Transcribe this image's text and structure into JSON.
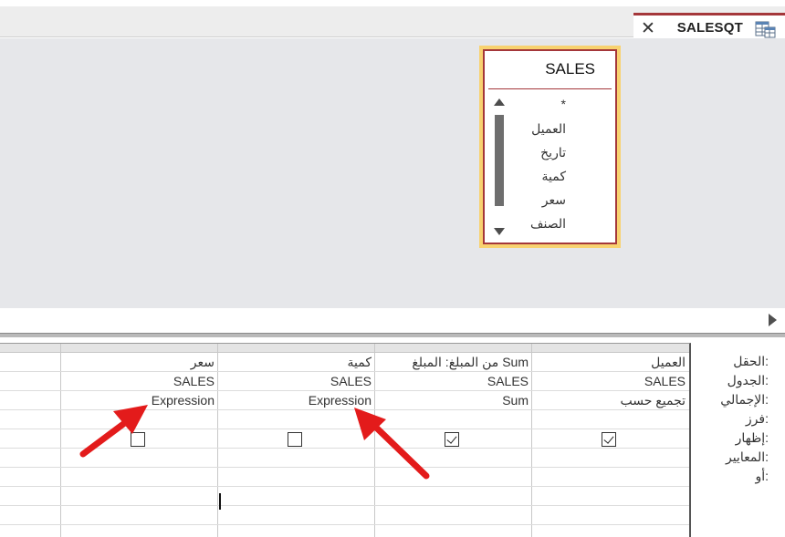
{
  "tab": {
    "title": "SALESQT",
    "icon": "query-design-icon",
    "close": "✕"
  },
  "table_box": {
    "title": "SALES",
    "fields": [
      "*",
      "العميل",
      "تاريخ",
      "كمية",
      "سعر",
      "الصنف"
    ]
  },
  "grid": {
    "row_labels": [
      "الحقل:",
      "الجدول:",
      "الإجمالي:",
      "فرز:",
      "إظهار:",
      "المعايير:",
      "أو:"
    ],
    "columns": [
      {
        "field": "العميل",
        "table": "SALES",
        "total": "تجميع حسب",
        "show": true
      },
      {
        "field": "من المبلغ: المبلغ Sum",
        "table": "SALES",
        "total": "Sum",
        "show": true
      },
      {
        "field": "كمية",
        "table": "SALES",
        "total": "Expression",
        "show": false
      },
      {
        "field": "سعر",
        "table": "SALES",
        "total": "Expression",
        "show": false
      }
    ]
  },
  "annotations": {
    "arrow_color": "#e31b1b"
  }
}
